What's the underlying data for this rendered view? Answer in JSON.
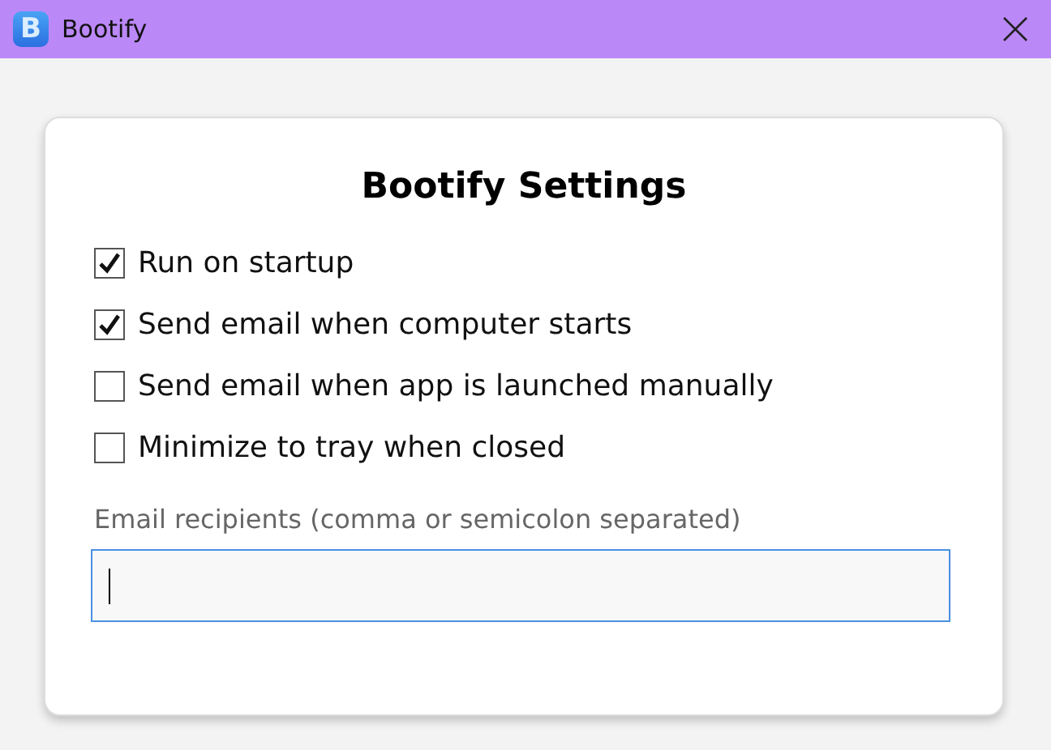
{
  "window": {
    "title": "Bootify",
    "logo_letter": "B"
  },
  "heading": "Bootify Settings",
  "options": [
    {
      "label": "Run on startup",
      "checked": true
    },
    {
      "label": "Send email when computer starts",
      "checked": true
    },
    {
      "label": "Send email when app is launched manually",
      "checked": false
    },
    {
      "label": "Minimize to tray when closed",
      "checked": false
    }
  ],
  "recipients": {
    "label": "Email recipients (comma or semicolon separated)",
    "focused": true
  }
}
